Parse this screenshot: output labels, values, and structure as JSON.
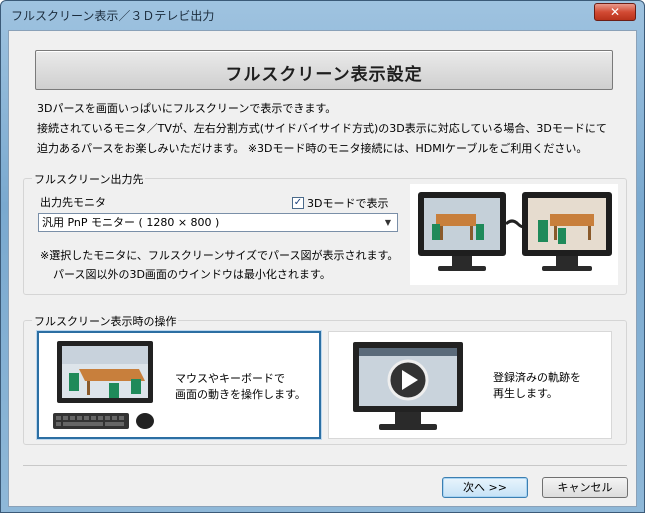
{
  "window": {
    "title": "フルスクリーン表示／３Ｄテレビ出力",
    "close_label": "✕"
  },
  "header": {
    "title": "フルスクリーン表示設定"
  },
  "description": [
    "3Dパースを画面いっぱいにフルスクリーンで表示できます。",
    "接続されているモニタ／TVが、左右分割方式(サイドバイサイド方式)の3D表示に対応している場合、3Dモードにて",
    "迫力あるパースをお楽しみいただけます。 ※3Dモード時のモニタ接続には、HDMIケーブルをご利用ください。"
  ],
  "output_group": {
    "label": "フルスクリーン出力先",
    "monitor_label": "出力先モニタ",
    "monitor_value": "汎用 PnP モニター ( 1280 × 800 )",
    "mode3d_label": "3Dモードで表示",
    "mode3d_checked": true,
    "note_line1": "※選択したモニタに、フルスクリーンサイズでパース図が表示されます。",
    "note_line2": "パース図以外の3D画面のウインドウは最小化されます。"
  },
  "operation_group": {
    "label": "フルスクリーン表示時の操作",
    "option1_line1": "マウスやキーボードで",
    "option1_line2": "画面の動きを操作します。",
    "option2_line1": "登録済みの軌跡を",
    "option2_line2": "再生します。"
  },
  "footer": {
    "next_label": "次へ >>",
    "cancel_label": "キャンセル"
  },
  "colors": {
    "accent": "#2c6fa3",
    "title_bar": "#8fb8d8",
    "close": "#d24b34"
  }
}
